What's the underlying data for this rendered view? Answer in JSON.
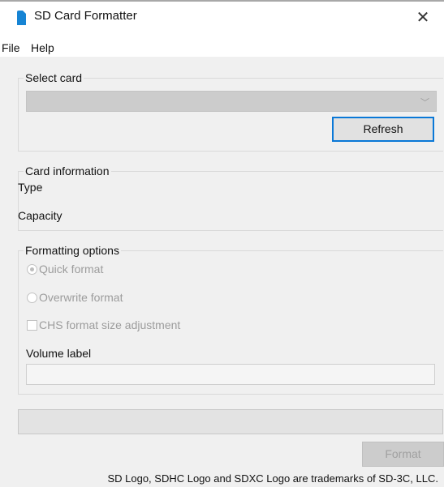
{
  "window": {
    "title": "SD Card Formatter",
    "close_glyph": "✕"
  },
  "menu": {
    "items": [
      {
        "label": "File"
      },
      {
        "label": "Help"
      }
    ]
  },
  "select_card": {
    "group_label": "Select card",
    "selected_value": "",
    "dropdown_glyph": "﹀",
    "refresh_label": "Refresh"
  },
  "card_info": {
    "group_label": "Card information",
    "type_label": "Type",
    "capacity_label": "Capacity"
  },
  "formatting_options": {
    "group_label": "Formatting options",
    "quick_format_label": "Quick format",
    "quick_format_checked": true,
    "overwrite_format_label": "Overwrite format",
    "overwrite_format_checked": false,
    "chs_label": "CHS format size adjustment",
    "chs_checked": false,
    "volume_label": "Volume label",
    "volume_value": ""
  },
  "progress": {
    "fraction": 0
  },
  "actions": {
    "format_label": "Format"
  },
  "footer": {
    "trademark_text": "SD Logo, SDHC Logo and SDXC Logo are trademarks of SD-3C, LLC."
  },
  "colors": {
    "accent_blue": "#0a78d7",
    "icon_blue": "#1684d4",
    "window_bg": "#f0f0f0",
    "disabled_text": "#9c9c9c"
  },
  "icons": {
    "app": "sd-card-icon",
    "close": "close-icon",
    "dropdown": "chevron-down-icon"
  }
}
